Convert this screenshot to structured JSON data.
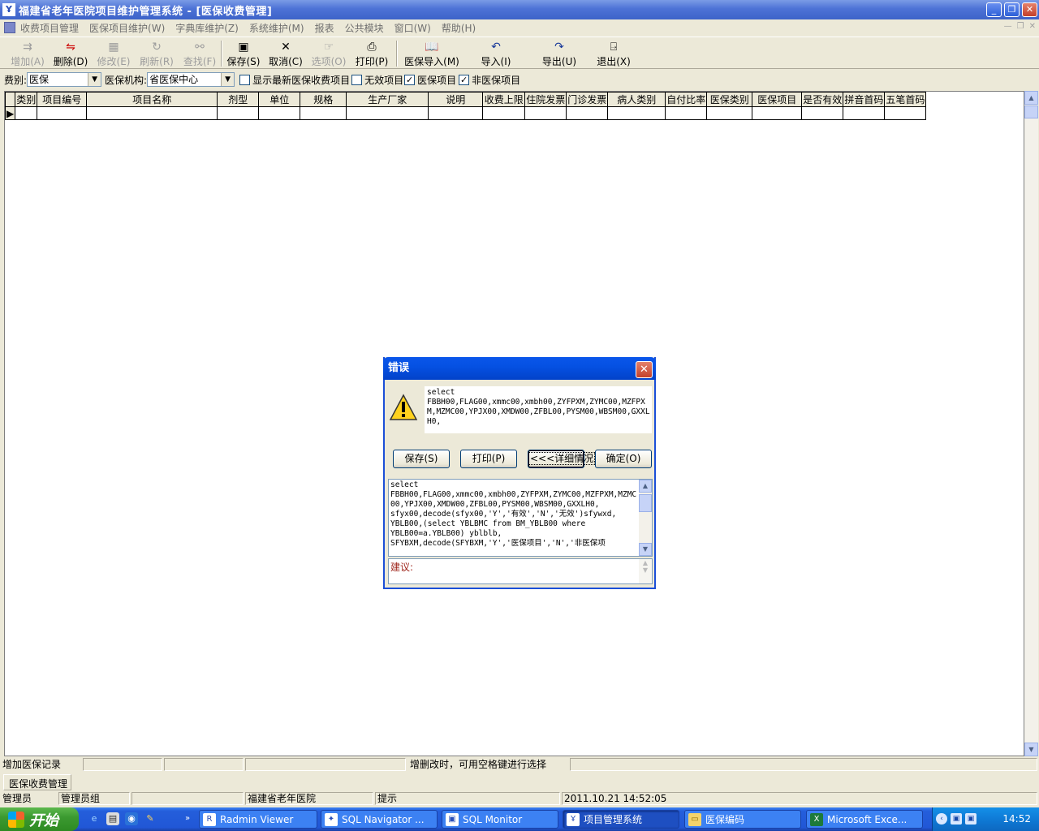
{
  "window": {
    "title": "福建省老年医院项目维护管理系统 - [医保收费管理]",
    "app_icon_glyph": "Ұ"
  },
  "menu": {
    "items": [
      "收费项目管理",
      "医保项目维护(W)",
      "字典库维护(Z)",
      "系统维护(M)",
      "报表",
      "公共模块",
      "窗口(W)",
      "帮助(H)"
    ]
  },
  "toolbar": {
    "add": "增加(A)",
    "delete": "删除(D)",
    "modify": "修改(E)",
    "refresh": "刷新(R)",
    "find": "查找(F)",
    "save": "保存(S)",
    "cancel": "取消(C)",
    "options": "选项(O)",
    "print": "打印(P)",
    "import_yb": "医保导入(M)",
    "import": "导入(I)",
    "export": "导出(U)",
    "exit": "退出(X)"
  },
  "filter": {
    "fee_label": "费别:",
    "fee_value": "医保",
    "org_label": "医保机构:",
    "org_value": "省医保中心",
    "show_latest": "显示最新医保收费项目",
    "show_latest_checked": false,
    "invalid_items": "无效项目",
    "invalid_checked": false,
    "yb_items": "医保项目",
    "yb_checked": true,
    "non_yb_items": "非医保项目",
    "non_yb_checked": true
  },
  "grid": {
    "columns": [
      "类别",
      "项目编号",
      "项目名称",
      "剂型",
      "单位",
      "规格",
      "生产厂家",
      "说明",
      "收费上限",
      "住院发票",
      "门诊发票",
      "病人类别",
      "自付比率",
      "医保类别",
      "医保项目",
      "是否有效",
      "拼音首码",
      "五笔首码"
    ]
  },
  "statusbar": {
    "record_action": "增加医保记录",
    "hint": "增删改时，可用空格键进行选择",
    "doc_tab": "医保收费管理",
    "user": "管理员",
    "group": "管理员组",
    "hospital": "福建省老年医院",
    "prompt": "提示",
    "datetime": "2011.10.21  14:52:05"
  },
  "dialog": {
    "title": "错误",
    "message": "select\nFBBH00,FLAG00,xmmc00,xmbh00,ZYFPXM,ZYMC00,MZFPXM,MZMC00,YPJX00,XMDW00,ZFBL00,PYSM00,WBSM00,GXXLH0,",
    "btn_save": "保存(S)",
    "btn_print": "打印(P)",
    "btn_detail": "<<<详细情况",
    "btn_ok": "确定(O)",
    "detail": "select\nFBBH00,FLAG00,xmmc00,xmbh00,ZYFPXM,ZYMC00,MZFPXM,MZMC00,YPJX00,XMDW00,ZFBL00,PYSM00,WBSM00,GXXLH0,\nsfyx00,decode(sfyx00,'Y','有效','N','无效')sfywxd,\nYBLB00,(select YBLBMC from BM_YBLB00 where\nYBLB00=a.YBLB00) yblblb,\nSFYBXM,decode(SFYBXM,'Y','医保项目','N','非医保项",
    "suggest_label": "建议:"
  },
  "taskbar": {
    "start": "开始",
    "tasks": [
      "Radmin Viewer",
      "SQL Navigator ...",
      "SQL Monitor",
      "项目管理系统",
      "医保编码",
      "Microsoft Exce..."
    ],
    "clock": "14:52"
  }
}
